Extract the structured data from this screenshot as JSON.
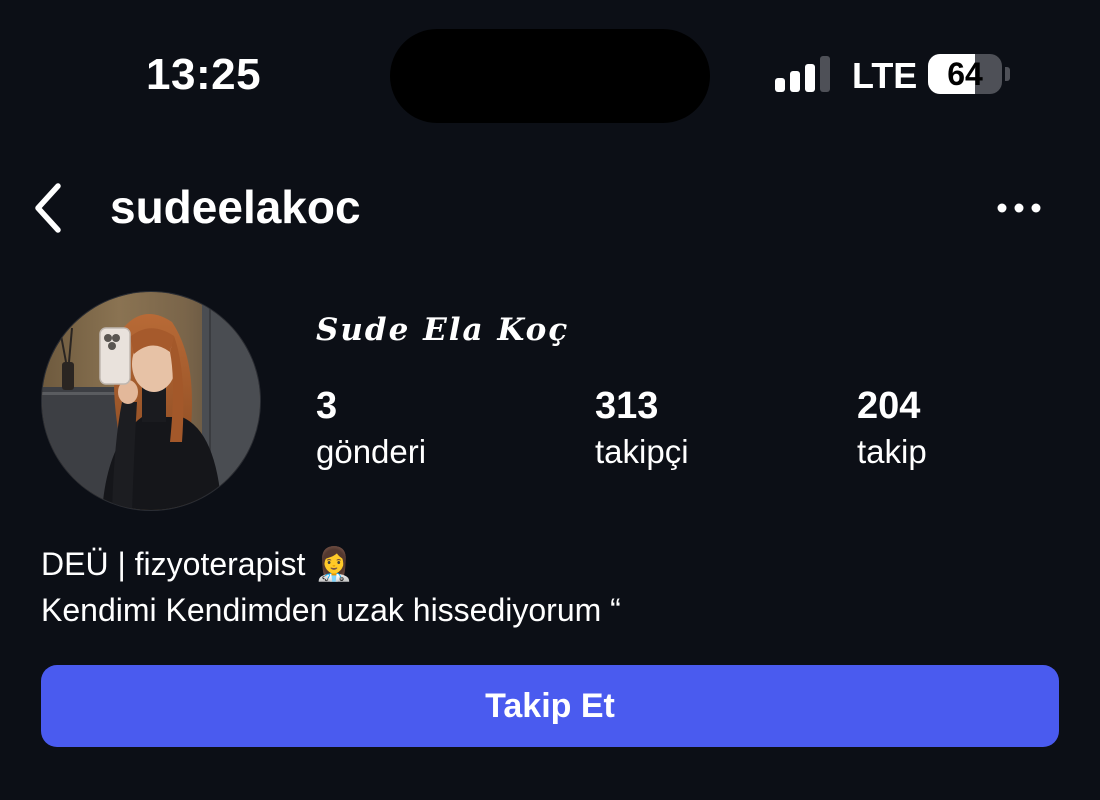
{
  "status_bar": {
    "time": "13:25",
    "network": "LTE",
    "battery": "64",
    "battery_level": 0.64,
    "signal_bars_active": 3,
    "signal_bars_total": 4
  },
  "header": {
    "username": "sudeelakoc",
    "back_icon": "chevron-left-icon",
    "more_icon": "ellipsis-icon"
  },
  "profile": {
    "display_name": "Sude Ela Koç",
    "stats": [
      {
        "count": "3",
        "label": "gönderi"
      },
      {
        "count": "313",
        "label": "takipçi"
      },
      {
        "count": "204",
        "label": "takip"
      }
    ],
    "bio": [
      "DEÜ | fizyoterapist 👩‍⚕️",
      "Kendimi Kendimden uzak hissediyorum “"
    ]
  },
  "actions": {
    "follow_label": "Takip Et"
  },
  "colors": {
    "background": "#0c0f16",
    "follow_button": "#4a5bef",
    "text": "#ffffff"
  }
}
